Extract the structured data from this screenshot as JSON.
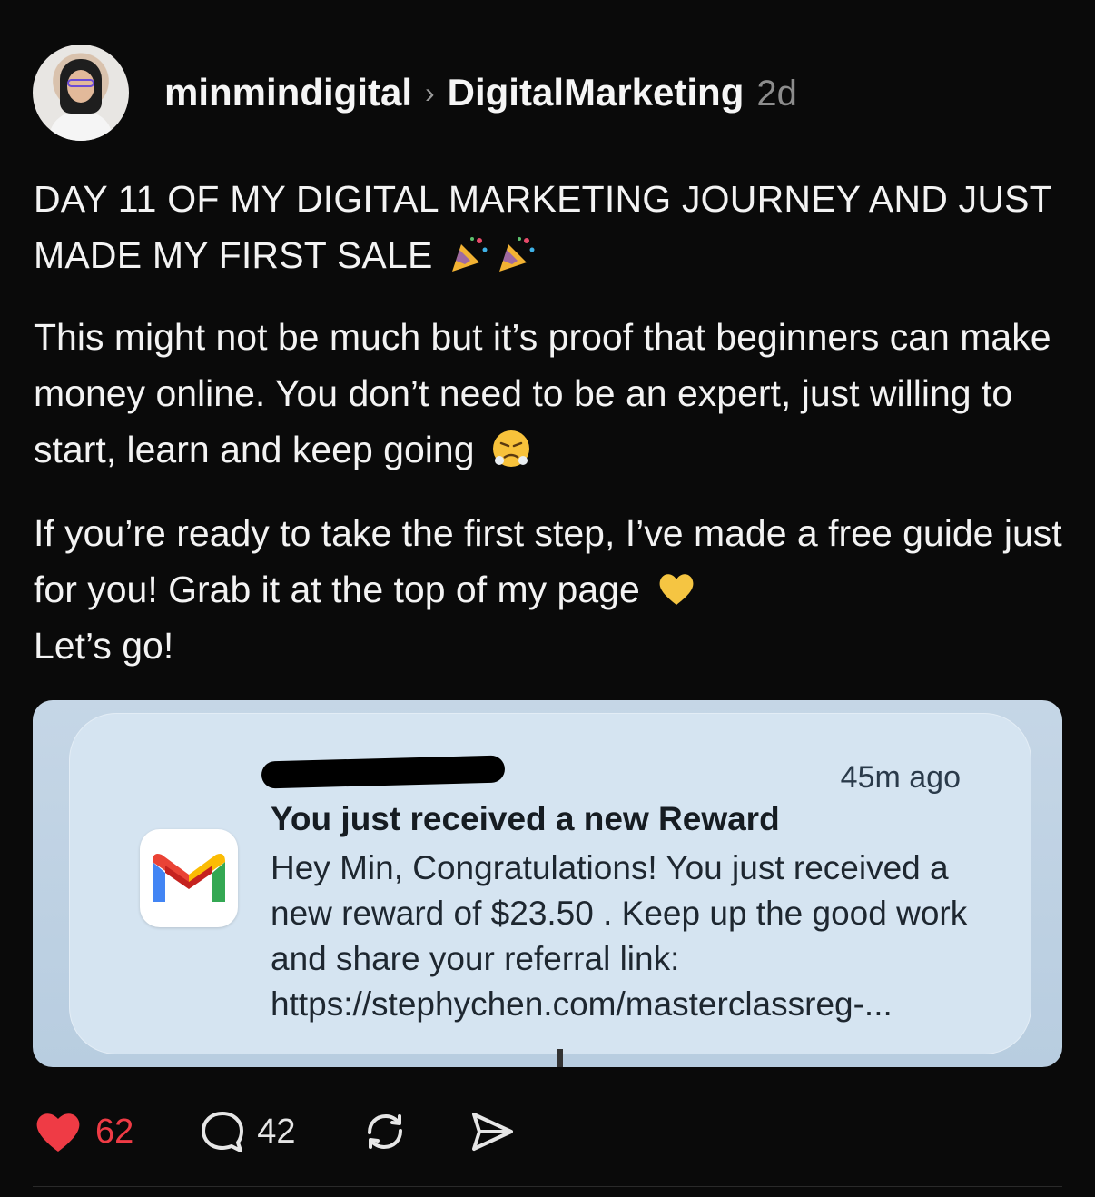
{
  "post": {
    "username": "minmindigital",
    "separator": "›",
    "community": "DigitalMarketing",
    "time": "2d",
    "headline": "DAY 11 OF MY DIGITAL MARKETING JOURNEY AND JUST MADE MY FIRST SALE",
    "paragraph1": "This might not be much but it’s proof that beginners can make money online. You don’t need to be an expert, just willing to start, learn and keep going",
    "paragraph2": "If you’re ready to take the first step, I’ve made a free guide just for you! Grab it at the top of my page",
    "paragraph3": "Let’s go!"
  },
  "notification": {
    "time": "45m ago",
    "title": "You just received a new Reward",
    "body": "Hey Min, Congratulations! You just received a new reward of $23.50 . Keep up the good work and share your referral link: https://stephychen.com/masterclassreg-..."
  },
  "actions": {
    "likes": "62",
    "replies": "42"
  },
  "icons": {
    "avatar": "profile-photo",
    "party": "party-popper-icon",
    "angry": "face-with-steam-icon",
    "heart_emoji": "yellow-heart-icon",
    "gmail": "gmail-icon",
    "like": "heart-icon",
    "reply": "comment-icon",
    "repost": "repost-icon",
    "share": "send-icon"
  },
  "colors": {
    "background": "#0a0a0a",
    "like_red": "#ef3b45",
    "notification_bg": "#d5e4f1"
  }
}
